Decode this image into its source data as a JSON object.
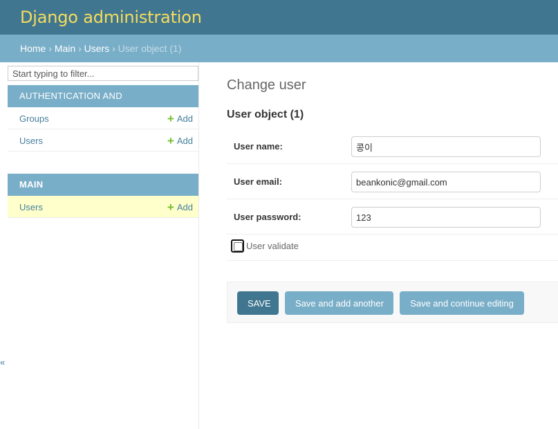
{
  "header": {
    "site_title": "Django administration"
  },
  "breadcrumbs": {
    "home": "Home",
    "app": "Main",
    "model": "Users",
    "current": "User object (1)",
    "separator": "›"
  },
  "sidebar": {
    "filter_placeholder": "Start typing to filter...",
    "modules": [
      {
        "caption": "AUTHENTICATION AND AUTHORIZATION",
        "models": [
          {
            "name": "Groups",
            "add_label": "Add"
          },
          {
            "name": "Users",
            "add_label": "Add"
          }
        ]
      },
      {
        "caption": "MAIN",
        "models": [
          {
            "name": "Users",
            "add_label": "Add",
            "selected": true
          }
        ]
      }
    ],
    "collapse_glyph": "«"
  },
  "main": {
    "heading": "Change user",
    "object_title": "User object (1)",
    "fields": [
      {
        "label": "User name:",
        "value": "콩이"
      },
      {
        "label": "User email:",
        "value": "beankonic@gmail.com"
      },
      {
        "label": "User password:",
        "value": "123"
      }
    ],
    "checkbox": {
      "label": "User validate",
      "checked": false
    },
    "buttons": {
      "save": "SAVE",
      "save_add": "Save and add another",
      "save_continue": "Save and continue editing"
    }
  },
  "colors": {
    "header_bg": "#417690",
    "breadcrumb_bg": "#79aec8",
    "site_title": "#f5dd5d",
    "link": "#447e9b",
    "add_plus": "#70bf2b",
    "selected_row_bg": "#ffffcc",
    "default_button": "#417690",
    "secondary_button": "#79aec8"
  },
  "icons": {
    "add": "plus-icon",
    "collapse": "collapse-icon"
  }
}
